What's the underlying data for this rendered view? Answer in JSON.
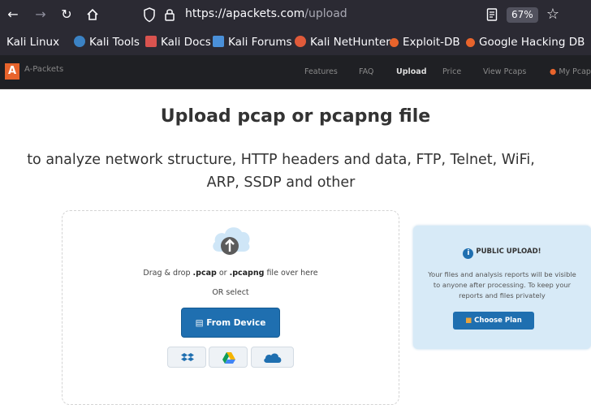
{
  "browser": {
    "url_host": "https://apackets.com",
    "url_path": "/upload",
    "zoom": "67%"
  },
  "bookmarks": [
    {
      "label": "Kali Linux",
      "icon": "kali-icon"
    },
    {
      "label": "Kali Tools",
      "icon": "kali-tools-icon"
    },
    {
      "label": "Kali Docs",
      "icon": "kali-docs-icon"
    },
    {
      "label": "Kali Forums",
      "icon": "kali-forums-icon"
    },
    {
      "label": "Kali NetHunter",
      "icon": "nethunter-icon"
    },
    {
      "label": "Exploit-DB",
      "icon": "exploit-db-icon"
    },
    {
      "label": "Google Hacking DB",
      "icon": "ghdb-icon"
    }
  ],
  "site": {
    "logo_letter": "A",
    "logo_text": "A-Packets",
    "nav": [
      "Features",
      "FAQ",
      "Upload",
      "Price",
      "View Pcaps",
      "My Pcap"
    ],
    "active_nav": "Upload"
  },
  "page": {
    "title": "Upload pcap or pcapng file",
    "subtitle_line1": "to analyze network structure, HTTP headers and data, FTP, Telnet, WiFi,",
    "subtitle_line2": "ARP, SSDP and other"
  },
  "upload": {
    "drag_prefix": "Drag & drop",
    "ext1": ".pcap",
    "drag_or": "or",
    "ext2": ".pcapng",
    "drag_suffix": "file over here",
    "or_select": "OR select",
    "from_device": "From Device",
    "services": [
      "dropbox-icon",
      "google-drive-icon",
      "onedrive-icon"
    ]
  },
  "notice": {
    "heading": "PUBLIC UPLOAD!",
    "body": "Your files and analysis reports will be visible to anyone after processing. To keep your reports and files privately",
    "button": "Choose Plan"
  },
  "colors": {
    "accent": "#1f6fb0",
    "brand_orange": "#e8642c",
    "notice_bg": "#d7eaf7"
  }
}
